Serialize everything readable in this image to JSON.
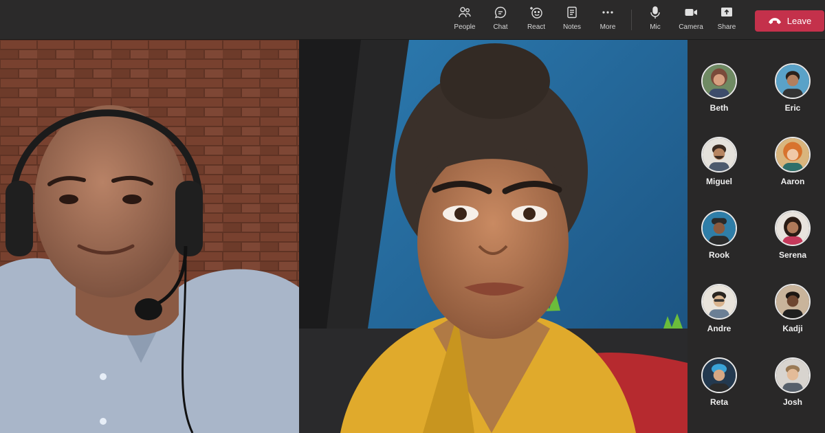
{
  "toolbar": {
    "items": [
      {
        "label": "People",
        "icon": "people-icon"
      },
      {
        "label": "Chat",
        "icon": "chat-icon"
      },
      {
        "label": "React",
        "icon": "react-icon"
      },
      {
        "label": "Notes",
        "icon": "notes-icon"
      },
      {
        "label": "More",
        "icon": "more-icon"
      },
      {
        "label": "Mic",
        "icon": "mic-icon"
      },
      {
        "label": "Camera",
        "icon": "camera-icon"
      },
      {
        "label": "Share",
        "icon": "share-icon"
      }
    ],
    "leave_label": "Leave",
    "leave_color": "#c4314b"
  },
  "participants": [
    {
      "name": "Beth"
    },
    {
      "name": "Eric"
    },
    {
      "name": "Miguel"
    },
    {
      "name": "Aaron"
    },
    {
      "name": "Rook"
    },
    {
      "name": "Serena"
    },
    {
      "name": "Andre"
    },
    {
      "name": "Kadji"
    },
    {
      "name": "Reta"
    },
    {
      "name": "Josh"
    }
  ]
}
